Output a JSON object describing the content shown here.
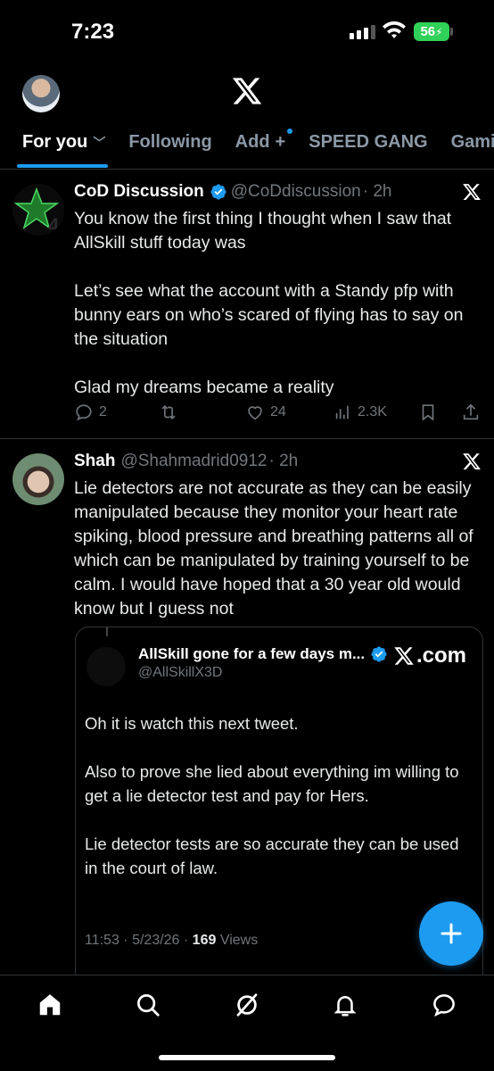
{
  "status_bar": {
    "time": "7:23",
    "battery": "56"
  },
  "header": {
    "logo": "x-logo",
    "tabs": [
      {
        "label": "For you",
        "active": true
      },
      {
        "label": "Following",
        "active": false
      },
      {
        "label": "Add",
        "active": false
      },
      {
        "label": "SPEED GANG",
        "active": false
      },
      {
        "label": "Gami",
        "active": false
      }
    ]
  },
  "posts": [
    {
      "name": "CoD Discussion",
      "verified": true,
      "handle": "@CoDdiscussion",
      "time": "· 2h",
      "text": "You know the first thing I thought when I saw that AllSkill stuff today was\n\nLet’s see what the account with a Standy pfp with bunny ears on who’s scared of flying has to say on the situation\n\nGlad my dreams became a reality",
      "replies": "2",
      "likes": "24",
      "views": "2.3K"
    },
    {
      "name": "Shah",
      "verified": false,
      "handle": "@Shahmadrid0912",
      "time": "· 2h",
      "text": "Lie detectors are not accurate as they can be easily manipulated because they monitor your heart rate spiking, blood pressure and breathing patterns all of which can be manipulated by training yourself to be calm. I would have hoped that a 30 year old would know but I guess not",
      "quote": {
        "name": "AllSkill gone for a few days m...",
        "handle": "@AllSkillX3D",
        "source": ".com",
        "text": "Oh it is watch this next tweet.\n\nAlso to prove she lied about everything im willing to get a lie detector test and pay for Hers.\n\nLie detector tests are so accurate they can be used in the court of law.",
        "meta_time": "11:53 · 5/23/26 · ",
        "views_count": "169",
        "views_label": " Views"
      }
    }
  ],
  "colors": {
    "accent": "#1d9bf0",
    "background": "#000000",
    "muted": "#71767b",
    "battery": "#30d158"
  },
  "bottom_nav": [
    "home-icon",
    "search-icon",
    "grok-icon",
    "notifications-icon",
    "messages-icon"
  ]
}
